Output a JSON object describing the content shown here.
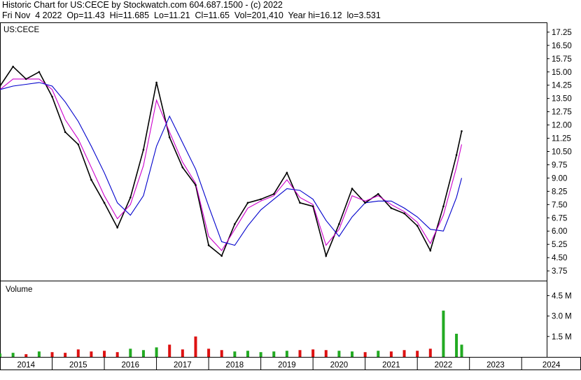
{
  "header": {
    "line1": "Historic Chart for US:CECE by Stockwatch.com 604.687.1500 - (c) 2022",
    "line2": "Fri Nov  4 2022  Op=11.43  Hi=11.685  Lo=11.21  Cl=11.65  Vol=201,410  Year hi=16.12  lo=3.531"
  },
  "colors": {
    "price": "#000000",
    "ma_short": "#cc00cc",
    "ma_long": "#0000cc",
    "volume_up": "#22aa22",
    "volume_down": "#dd1111",
    "grid": "#000000"
  },
  "chart_data": [
    {
      "type": "line",
      "title": "US:CECE",
      "ylim": [
        3.2,
        17.8
      ],
      "y_ticks": [
        "17.25",
        "16.50",
        "15.75",
        "15.00",
        "14.25",
        "13.50",
        "12.75",
        "12.00",
        "11.25",
        "10.50",
        "9.75",
        "9.00",
        "8.25",
        "7.50",
        "6.75",
        "6.00",
        "5.25",
        "4.50",
        "3.75"
      ],
      "x": [
        2014.0,
        2014.25,
        2014.5,
        2014.75,
        2015.0,
        2015.25,
        2015.5,
        2015.75,
        2016.0,
        2016.25,
        2016.5,
        2016.75,
        2017.0,
        2017.25,
        2017.5,
        2017.75,
        2018.0,
        2018.25,
        2018.5,
        2018.75,
        2019.0,
        2019.25,
        2019.5,
        2019.75,
        2020.0,
        2020.25,
        2020.5,
        2020.75,
        2021.0,
        2021.25,
        2021.5,
        2021.75,
        2022.0,
        2022.25,
        2022.5,
        2022.75,
        2022.85
      ],
      "series": [
        {
          "values": [
            14.2,
            15.3,
            14.6,
            15.0,
            13.6,
            11.6,
            10.9,
            8.9,
            7.6,
            6.2,
            7.9,
            10.6,
            14.4,
            11.3,
            9.6,
            8.6,
            5.2,
            4.6,
            6.4,
            7.6,
            7.8,
            8.1,
            9.3,
            7.6,
            7.4,
            4.6,
            6.4,
            8.4,
            7.6,
            8.1,
            7.3,
            7.0,
            6.3,
            4.9,
            7.4,
            10.3,
            11.65
          ]
        },
        {
          "values": [
            14.0,
            14.6,
            14.6,
            14.6,
            14.0,
            12.3,
            11.2,
            9.6,
            8.0,
            6.7,
            7.5,
            9.7,
            13.4,
            11.6,
            9.9,
            8.7,
            5.7,
            4.9,
            6.1,
            7.3,
            7.7,
            8.0,
            8.9,
            7.9,
            7.5,
            5.2,
            6.1,
            8.0,
            7.7,
            8.0,
            7.5,
            7.1,
            6.5,
            5.3,
            6.9,
            9.6,
            10.9
          ]
        },
        {
          "values": [
            14.0,
            14.2,
            14.3,
            14.4,
            14.2,
            13.3,
            12.2,
            10.8,
            9.3,
            7.6,
            6.9,
            8.0,
            10.8,
            12.5,
            11.0,
            9.5,
            7.4,
            5.4,
            5.2,
            6.3,
            7.2,
            7.8,
            8.4,
            8.3,
            7.8,
            6.6,
            5.7,
            6.8,
            7.6,
            7.7,
            7.7,
            7.3,
            6.8,
            6.1,
            6.0,
            7.9,
            9.0
          ]
        }
      ]
    },
    {
      "type": "bar",
      "title": "Volume",
      "ylim": [
        0,
        5.6
      ],
      "y_ticks": [
        "4.5 M",
        "3.0 M",
        "1.5 M"
      ],
      "x_ticks": [
        "2014",
        "2015",
        "2016",
        "2017",
        "2018",
        "2019",
        "2020",
        "2021",
        "2022",
        "2023",
        "2024"
      ],
      "x": [
        2014.0,
        2014.25,
        2014.5,
        2014.75,
        2015.0,
        2015.25,
        2015.5,
        2015.75,
        2016.0,
        2016.25,
        2016.5,
        2016.75,
        2017.0,
        2017.25,
        2017.5,
        2017.75,
        2018.0,
        2018.25,
        2018.5,
        2018.75,
        2019.0,
        2019.25,
        2019.5,
        2019.75,
        2020.0,
        2020.25,
        2020.5,
        2020.75,
        2021.0,
        2021.25,
        2021.5,
        2021.75,
        2022.0,
        2022.25,
        2022.5,
        2022.75,
        2022.85
      ],
      "values": [
        0.25,
        0.3,
        0.2,
        0.4,
        0.35,
        0.3,
        0.55,
        0.4,
        0.45,
        0.35,
        0.6,
        0.5,
        0.7,
        0.9,
        0.55,
        1.5,
        0.6,
        0.5,
        0.4,
        0.45,
        0.35,
        0.4,
        0.45,
        0.5,
        0.55,
        0.5,
        0.45,
        0.4,
        0.35,
        0.45,
        0.4,
        0.5,
        0.45,
        0.6,
        3.4,
        1.7,
        0.9
      ]
    }
  ]
}
